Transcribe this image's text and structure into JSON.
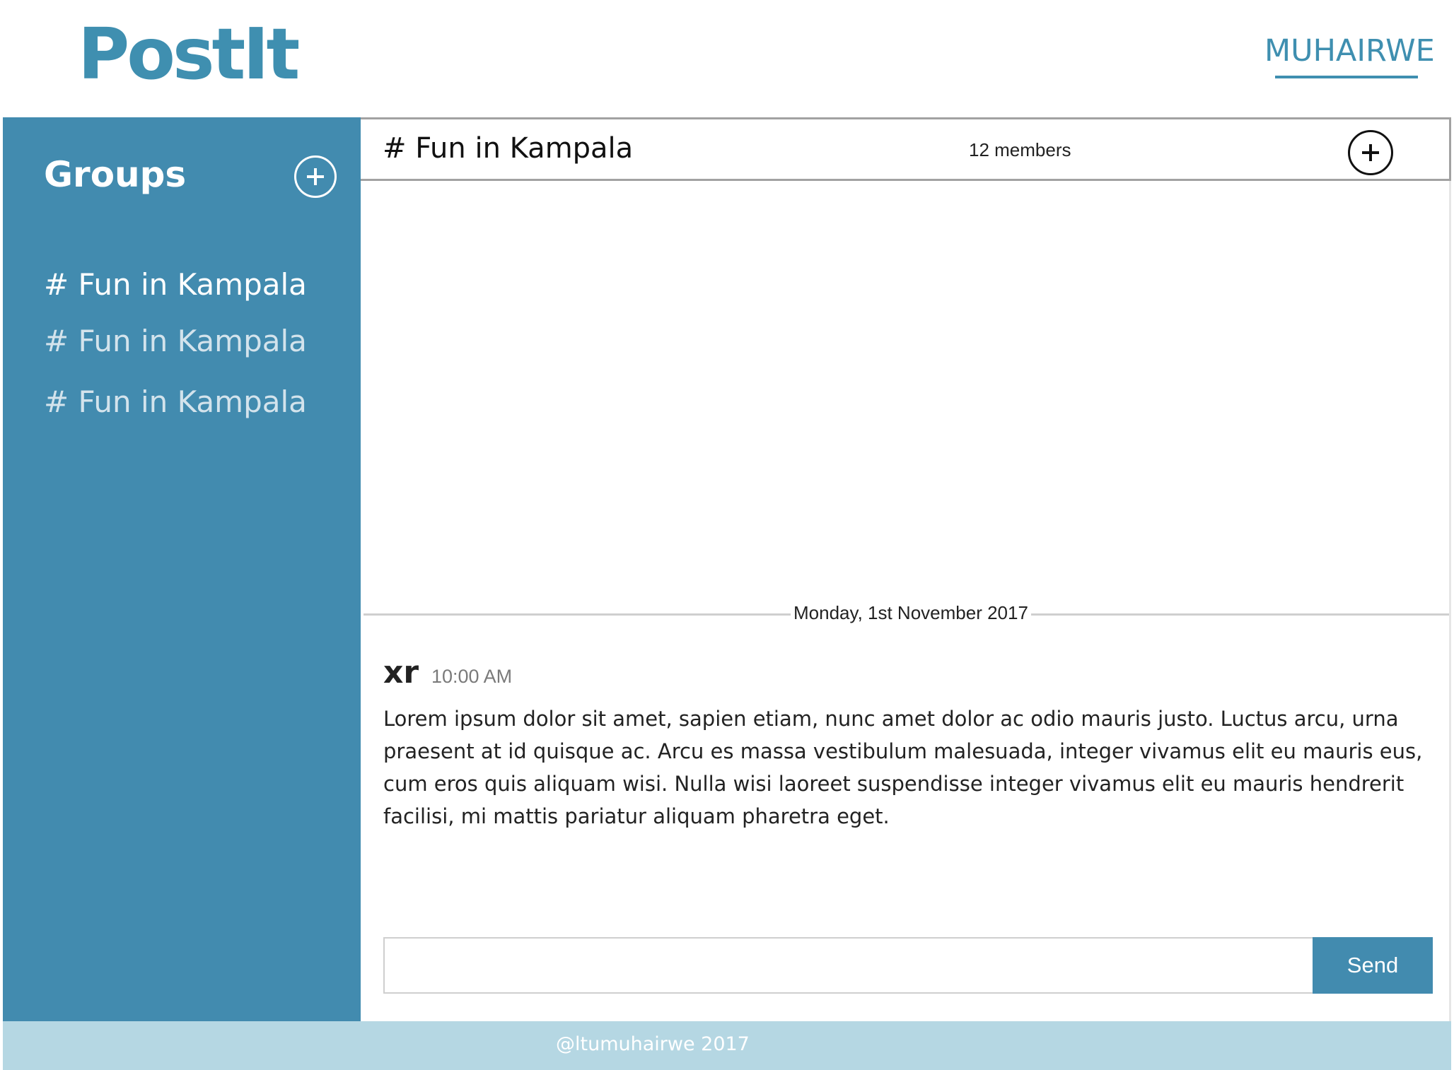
{
  "app": {
    "logo": "PostIt",
    "user": "MUHAIRWE"
  },
  "sidebar": {
    "title": "Groups",
    "add_icon": "plus-circle-icon",
    "groups": [
      {
        "label": "# Fun in Kampala",
        "active": true
      },
      {
        "label": "# Fun in Kampala",
        "active": false
      },
      {
        "label": "# Fun in Kampala",
        "active": false
      }
    ]
  },
  "channel": {
    "name": "# Fun in Kampala",
    "members": "12 members",
    "add_member_icon": "plus-circle-icon"
  },
  "messages": {
    "date_divider": "Monday, 1st November 2017",
    "items": [
      {
        "author": "xr",
        "time": "10:00 AM",
        "text": "Lorem ipsum dolor sit amet, sapien etiam, nunc amet dolor ac odio mauris justo. Luctus arcu, urna praesent at id quisque ac. Arcu es massa vestibulum malesuada, integer vivamus elit eu mauris eus, cum eros quis aliquam wisi. Nulla wisi laoreet suspendisse integer vivamus elit eu mauris hendrerit facilisi, mi mattis pariatur aliquam pharetra eget."
      }
    ]
  },
  "composer": {
    "value": "",
    "placeholder": "",
    "send_label": "Send"
  },
  "footer": {
    "text": "@ltumuhairwe 2017"
  },
  "colors": {
    "brand": "#3f8fb0",
    "sidebar": "#428baf",
    "footer": "#b5d7e3"
  }
}
